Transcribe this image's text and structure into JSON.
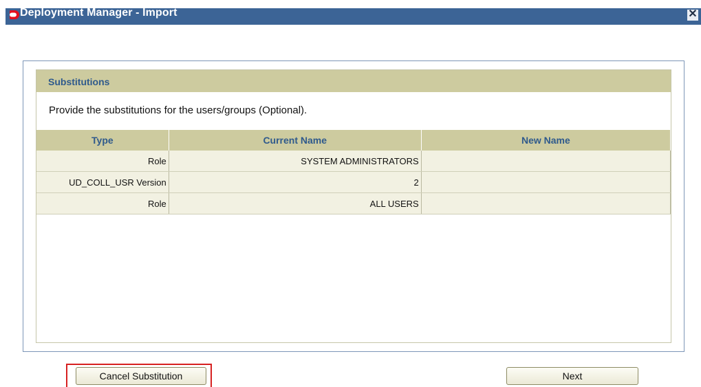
{
  "window": {
    "title": "Deployment Manager - Import",
    "logo_icon": "oracle-logo-icon",
    "close_icon": "close-icon",
    "close_glyph": "✕"
  },
  "panel": {
    "header": "Substitutions",
    "instructions": "Provide the substitutions for the users/groups (Optional).",
    "columns": [
      "Type",
      "Current Name",
      "New Name"
    ],
    "rows": [
      {
        "type": "Role",
        "current_name": "SYSTEM ADMINISTRATORS",
        "new_name": ""
      },
      {
        "type": "UD_COLL_USR Version",
        "current_name": "2",
        "new_name": ""
      },
      {
        "type": "Role",
        "current_name": "ALL USERS",
        "new_name": ""
      }
    ]
  },
  "buttons": {
    "cancel_substitution": "Cancel Substitution",
    "next": "Next"
  },
  "colors": {
    "titlebar": "#3c6496",
    "header_bg": "#cdcb9f",
    "header_text": "#2f5a8c",
    "row_bg": "#f2f1e2",
    "highlight": "#d62020"
  }
}
